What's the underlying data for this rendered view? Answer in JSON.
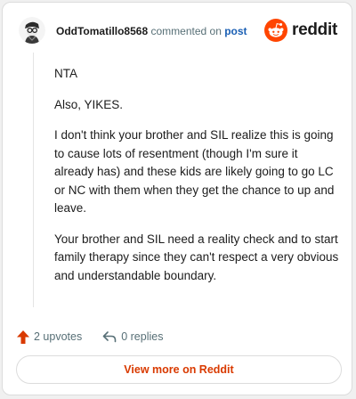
{
  "comment": {
    "username": "OddTomatillo8568",
    "action_text": "commented on",
    "post_link": "post",
    "paragraphs": [
      "NTA",
      "Also, YIKES.",
      "I don't think your brother and SIL realize this is going to cause lots of resentment (though I'm sure it already has) and these kids are likely going to go LC or NC with them when they get the chance to up and leave.",
      "Your brother and SIL need a reality check and to start family therapy since they can't respect a very obvious and understandable boundary."
    ]
  },
  "brand": {
    "name": "reddit",
    "icon": "reddit-snoo-icon",
    "color": "#ff4500"
  },
  "actions": {
    "upvotes": "2 upvotes",
    "replies": "0 replies"
  },
  "footer": {
    "view_more_label": "View more on Reddit"
  },
  "colors": {
    "accent": "#d93a00",
    "upvote": "#d93a00",
    "link": "#1a5fb4",
    "muted": "#576f76"
  }
}
